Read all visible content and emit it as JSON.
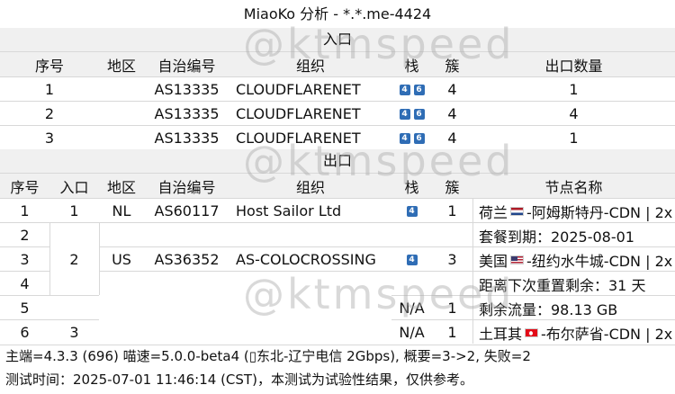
{
  "title": "MiaoKo 分析 - *.*.me-4424",
  "watermark": "@ktmspeed",
  "entry": {
    "section_label": "入口",
    "headers": [
      "序号",
      "地区",
      "自治编号",
      "组织",
      "栈",
      "簇",
      "出口数量"
    ],
    "rows": [
      {
        "idx": "1",
        "region": "",
        "asn": "AS13335",
        "org": "CLOUDFLARENET",
        "stack": [
          "4",
          "6"
        ],
        "cluster": "4",
        "count": "1"
      },
      {
        "idx": "2",
        "region": "",
        "asn": "AS13335",
        "org": "CLOUDFLARENET",
        "stack": [
          "4",
          "6"
        ],
        "cluster": "4",
        "count": "4"
      },
      {
        "idx": "3",
        "region": "",
        "asn": "AS13335",
        "org": "CLOUDFLARENET",
        "stack": [
          "4",
          "6"
        ],
        "cluster": "4",
        "count": "1"
      }
    ]
  },
  "exit": {
    "section_label": "出口",
    "headers": [
      "序号",
      "入口",
      "地区",
      "自治编号",
      "组织",
      "栈",
      "簇",
      "节点名称"
    ],
    "rows": [
      {
        "idx": "1",
        "entry": "1",
        "region": "NL",
        "asn": "AS60117",
        "org": "Host Sailor Ltd",
        "stack": "4",
        "cluster": "1",
        "flag": "nl",
        "node_pre": "荷兰",
        "node_post": "-阿姆斯特丹-CDN | 2x"
      },
      {
        "idx": "2",
        "node_text": "套餐到期：2025-08-01"
      },
      {
        "idx": "3",
        "entry": "2",
        "region": "US",
        "asn": "AS36352",
        "org": "AS-COLOCROSSING",
        "stack": "4",
        "cluster": "3",
        "flag": "us",
        "node_pre": "美国",
        "node_post": "-纽约水牛城-CDN | 2x"
      },
      {
        "idx": "4",
        "node_text": "距离下次重置剩余：31 天"
      },
      {
        "idx": "5",
        "stack": "N/A",
        "cluster": "1",
        "node_text": "剩余流量：98.13 GB"
      },
      {
        "idx": "6",
        "entry": "3",
        "stack": "N/A",
        "cluster": "1",
        "flag": "tr",
        "node_pre": "土耳其",
        "node_post": "-布尔萨省-CDN | 2x"
      }
    ]
  },
  "footer": {
    "line1": "主端=4.3.3 (696) 喵速=5.0.0-beta4 (▯东北-辽宁电信 2Gbps), 概要=3->2, 失败=2",
    "line2": "测试时间：2025-07-01 11:46:14 (CST)，本测试为试验性结果，仅供参考。"
  },
  "colors": {
    "badge": "#2f6db5",
    "section_bg": "#f0f0f0",
    "border": "#d8d8d8"
  }
}
